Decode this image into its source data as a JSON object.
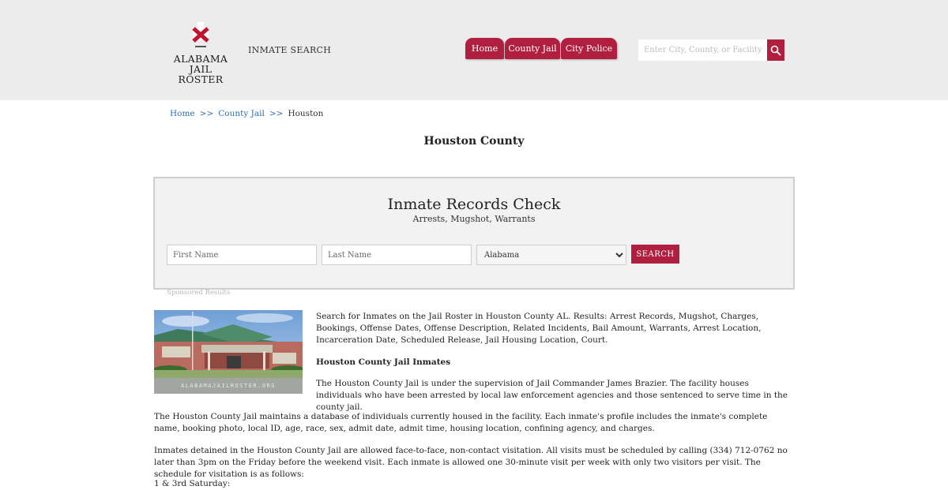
{
  "header": {
    "logo_line1": "ALABAMA",
    "logo_line2": "JAIL ROSTER",
    "inmate_search_label": "INMATE SEARCH",
    "nav": [
      "Home",
      "County Jail",
      "City Police"
    ],
    "search_placeholder": "Enter City, County, or Facility",
    "brand_color": "#b01f3f"
  },
  "breadcrumb": {
    "home": "Home",
    "sep1": ">>",
    "county_jail": "County Jail",
    "sep2": ">>",
    "current": "Houston"
  },
  "page_title": "Houston County",
  "records_check": {
    "title": "Inmate Records Check",
    "subtitle": "Arrests, Mugshot, Warrants",
    "first_name_placeholder": "First Name",
    "last_name_placeholder": "Last Name",
    "state_selected": "Alabama",
    "search_label": "SEARCH",
    "sponsored_text": "Sponsored Results"
  },
  "photo": {
    "watermark": "ALABAMAJAILROSTER.ORG"
  },
  "content": {
    "intro": "Search for Inmates on the Jail Roster in Houston County AL. Results: Arrest Records, Mugshot, Charges, Bookings, Offense Dates, Offense Description, Related Incidents, Bail Amount, Warrants, Arrest Location, Incarceration Date, Scheduled Release, Jail Housing Location, Court.",
    "inmates_heading": "Houston County Jail Inmates",
    "supervision": "The Houston County Jail is under the supervision of Jail Commander James Brazier. The facility houses individuals who have been arrested by local law enforcement agencies and those sentenced to serve time in the county jail.",
    "database": "The Houston County Jail maintains a database of individuals currently housed in the facility. Each inmate's profile includes the inmate's complete name, booking photo, local ID, age, race, sex, admit date, admit time, housing location, confining agency, and charges.",
    "visitation": "Inmates detained in the Houston County Jail are allowed face-to-face, non-contact visitation. All visits must be scheduled by calling (334) 712-0762 no later than 3pm on the Friday before the weekend visit. Each inmate is allowed one 30-minute visit per week with only two visitors per visit. The schedule for visitation is as follows:",
    "schedule_heading": "1 & 3rd Saturday:"
  }
}
